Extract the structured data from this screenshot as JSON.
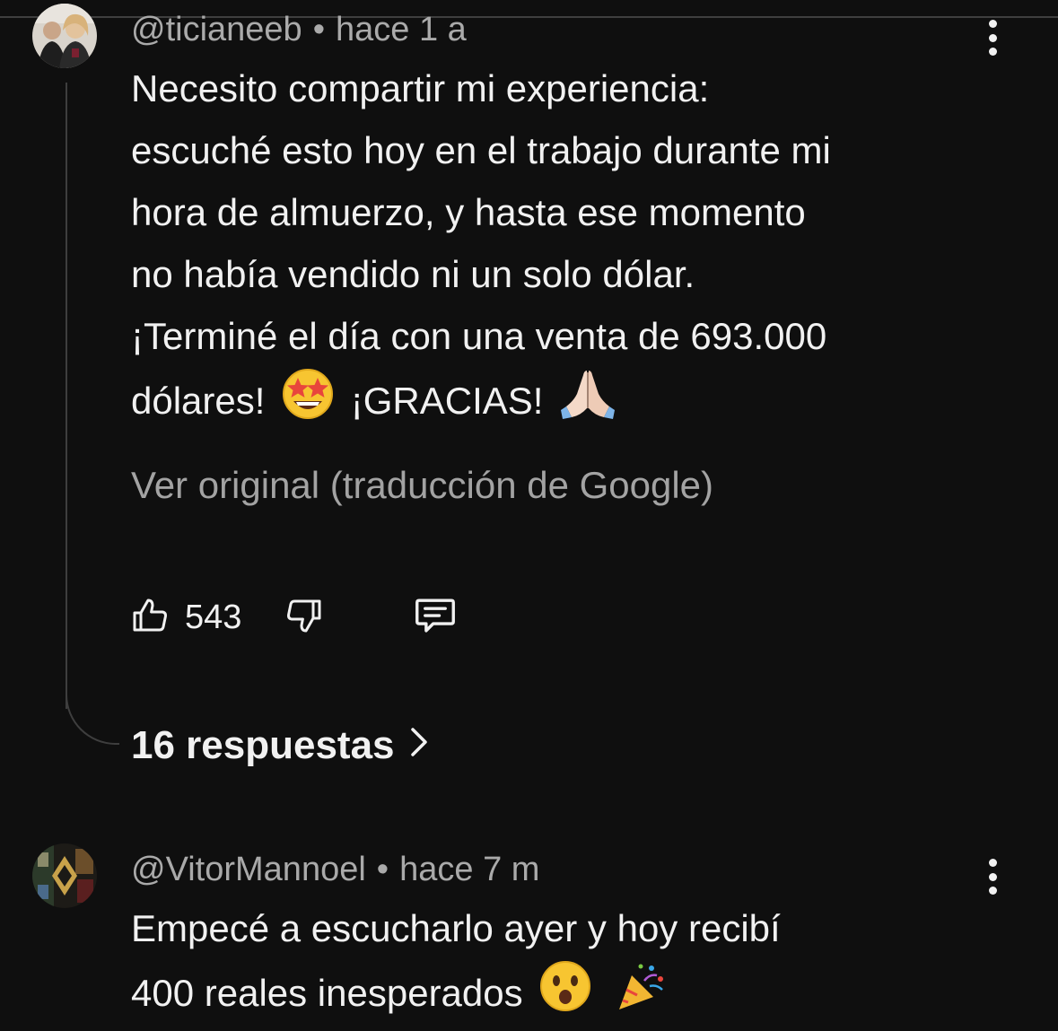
{
  "comments": [
    {
      "handle": "@ticianeeb",
      "separator": "•",
      "time": "hace 1 a",
      "lines": [
        "Necesito compartir mi experiencia:",
        "escuché esto hoy en el trabajo durante mi",
        "hora de almuerzo, y hasta ese momento",
        "no había vendido ni un solo dólar.",
        "¡Terminé el día con una venta de 693.000"
      ],
      "last_line": {
        "part1": "dólares!",
        "part2": "¡GRACIAS!"
      },
      "translate_link": "Ver original (traducción de Google)",
      "likes": "543",
      "replies_label": "16 respuestas",
      "icons": [
        "star-struck-emoji",
        "folded-hands-emoji",
        "thumbs-up-icon",
        "thumbs-down-icon",
        "reply-comment-icon",
        "more-vert-icon",
        "chevron-right-icon"
      ]
    },
    {
      "handle": "@VitorMannoel",
      "separator": "•",
      "time": "hace 7 m",
      "lines": [
        "Empecé a escucharlo ayer y hoy recibí"
      ],
      "last_line": {
        "part1": "400 reales inesperados"
      },
      "icons": [
        "hushed-face-emoji",
        "party-popper-emoji",
        "more-vert-icon"
      ]
    }
  ],
  "colors": {
    "background": "#0f0f0f",
    "primary_text": "#f1f1f1",
    "secondary_text": "#aaaaaa",
    "thread_line": "#3e3e3e"
  }
}
